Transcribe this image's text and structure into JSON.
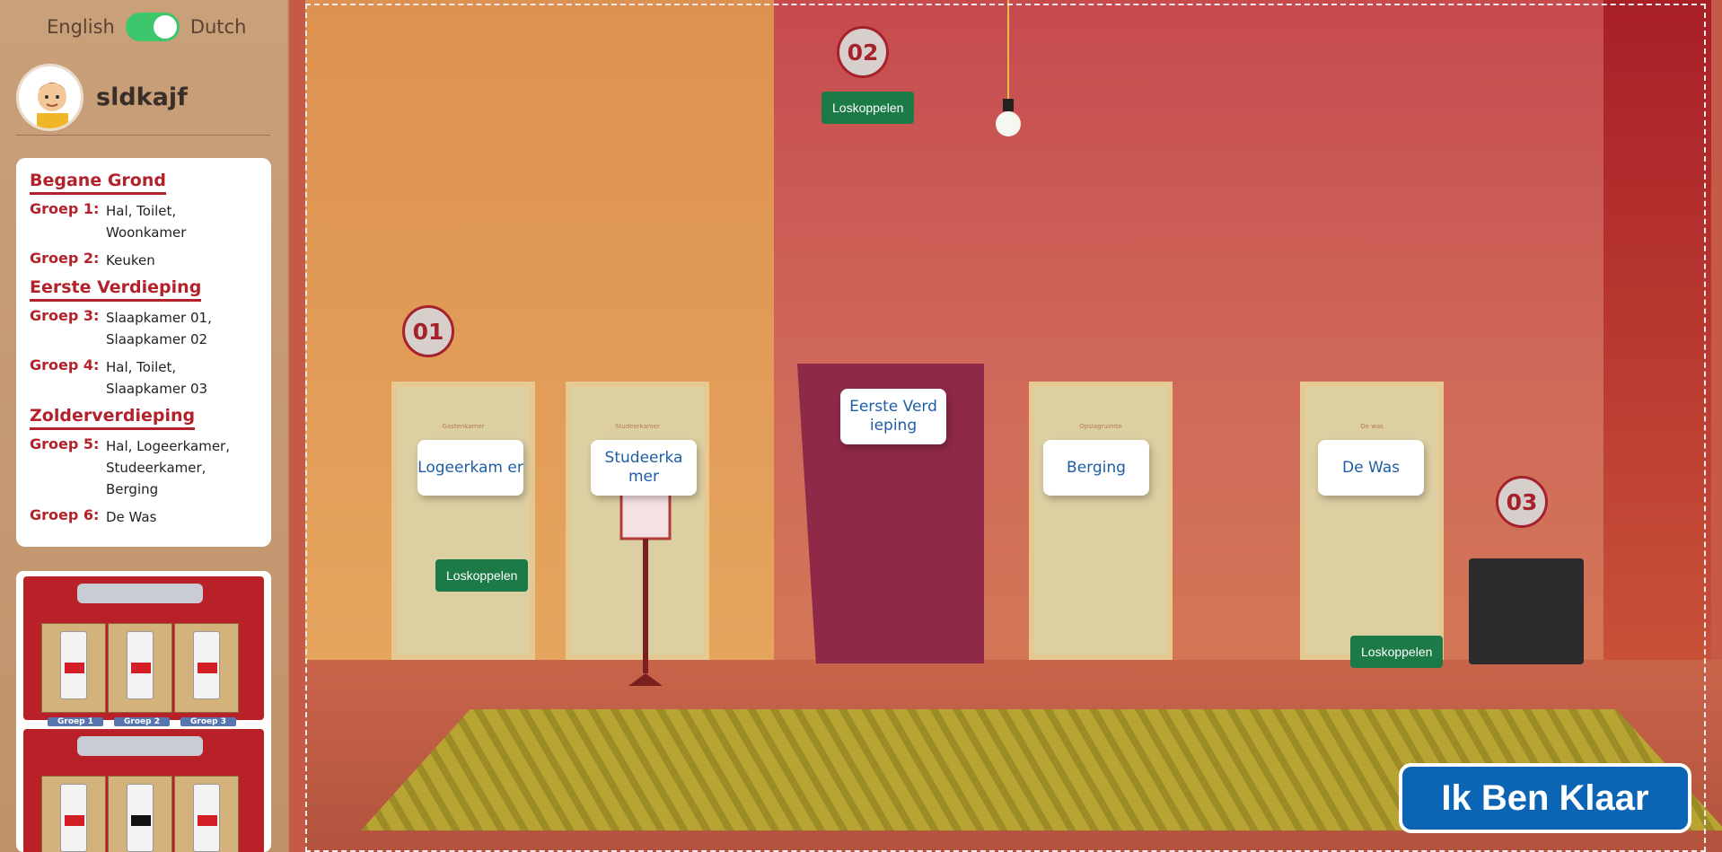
{
  "language": {
    "left": "English",
    "right": "Dutch",
    "active": "Dutch"
  },
  "user": {
    "name": "sldkajf"
  },
  "floors": [
    {
      "title": "Begane Grond",
      "groups": [
        {
          "label": "Groep 1:",
          "rooms": "Hal, Toilet, Woonkamer"
        },
        {
          "label": "Groep 2:",
          "rooms": "Keuken"
        }
      ]
    },
    {
      "title": "Eerste Verdieping",
      "groups": [
        {
          "label": "Groep 3:",
          "rooms": "Slaapkamer 01, Slaapkamer 02"
        },
        {
          "label": "Groep 4:",
          "rooms": "Hal, Toilet, Slaapkamer 03"
        }
      ]
    },
    {
      "title": "Zolderverdieping",
      "groups": [
        {
          "label": "Groep 5:",
          "rooms": "Hal, Logeerkamer, Studeerkamer, Berging"
        },
        {
          "label": "Groep 6:",
          "rooms": "De Was"
        }
      ]
    }
  ],
  "panel": {
    "tags": [
      "Groep 1",
      "Groep 2",
      "Groep 3"
    ]
  },
  "scene": {
    "doors": [
      {
        "plate": "Gastenkamer"
      },
      {
        "plate": "Studeerkamer"
      },
      {
        "plate": "Opslagruimte"
      },
      {
        "plate": "De was"
      }
    ],
    "rooms": [
      {
        "label": "Logeerkam er"
      },
      {
        "label": "Studeerka mer"
      },
      {
        "label": "Eerste Verd ieping"
      },
      {
        "label": "Berging"
      },
      {
        "label": "De Was"
      }
    ],
    "markers": [
      "01",
      "02",
      "03"
    ],
    "disconnect_label": "Loskoppelen"
  },
  "done_button": "Ik Ben Klaar",
  "colors": {
    "accent_red": "#b3212b",
    "button_green": "#1c7a46",
    "done_blue": "#0b64b4"
  }
}
